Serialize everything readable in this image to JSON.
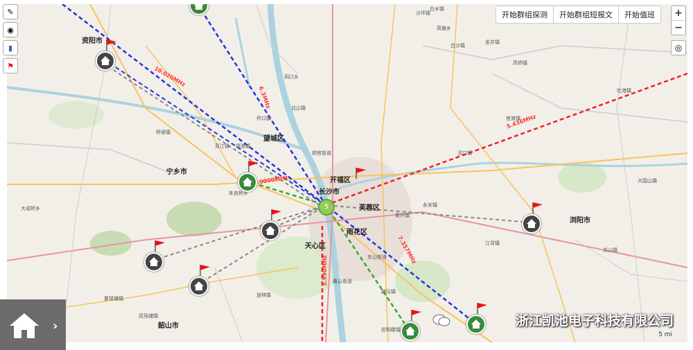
{
  "toolbar": {
    "tools": [
      {
        "name": "draw-icon",
        "glyph": "✎"
      },
      {
        "name": "signal-icon",
        "glyph": "◉"
      },
      {
        "name": "chart-icon",
        "glyph": "▮"
      },
      {
        "name": "flag-icon",
        "glyph": "⚑"
      }
    ]
  },
  "actions": {
    "group_probe": "开始群组探测",
    "group_sms": "开始群组短报文",
    "duty": "开始值班"
  },
  "zoom": {
    "in": "+",
    "out": "−"
  },
  "watermark": {
    "text": "浙江凯池电子科技有限公司"
  },
  "scale": {
    "text": "5 mi"
  },
  "cities": {
    "ziyang": "资阳市",
    "ningxiang": "宁乡市",
    "changsha": "长沙市",
    "kaifu": "开福区",
    "furong": "芙蓉区",
    "yuhua": "雨花区",
    "liuyang": "浏阳市",
    "shaoshan": "韶山市",
    "wangcheng": "望城区",
    "tianxin": "天心区"
  },
  "places": [
    "白水镇",
    "沙坪镇",
    "高塘乡",
    "双江镇",
    "洞口乡",
    "白沙镇",
    "金井镇",
    "高桥镇",
    "大成桥乡",
    "夏铎铺镇",
    "双凫铺镇",
    "道林镇",
    "花明楼镇",
    "朱良桥乡",
    "桥驿镇",
    "北山镇",
    "黄兴镇",
    "江背镇",
    "跳马镇",
    "暮云街道",
    "靖港镇",
    "乔口镇",
    "铜官街道",
    "东山街道",
    "永安镇",
    "淳口镇",
    "官渡镇",
    "社港镇",
    "关山镇",
    "大围山镇"
  ],
  "frequencies": [
    {
      "label": "5.436MHz",
      "color": "#ff3333"
    },
    {
      "label": "6.3MHz",
      "color": "#ff3333"
    },
    {
      "label": "10.020MHz",
      "color": "#ff3333"
    },
    {
      "label": "5.990MHz",
      "color": "#ff3333"
    },
    {
      "label": "7.357MHz",
      "color": "#ff3333"
    },
    {
      "label": "18.0000MHz",
      "color": "#ff3333"
    }
  ],
  "cluster": {
    "count": "5"
  },
  "colors": {
    "blue_link": "#2233dd",
    "red_link": "#ee2222",
    "green_link": "#33aa33",
    "gray_link": "#888888",
    "flag": "#ee1111"
  }
}
